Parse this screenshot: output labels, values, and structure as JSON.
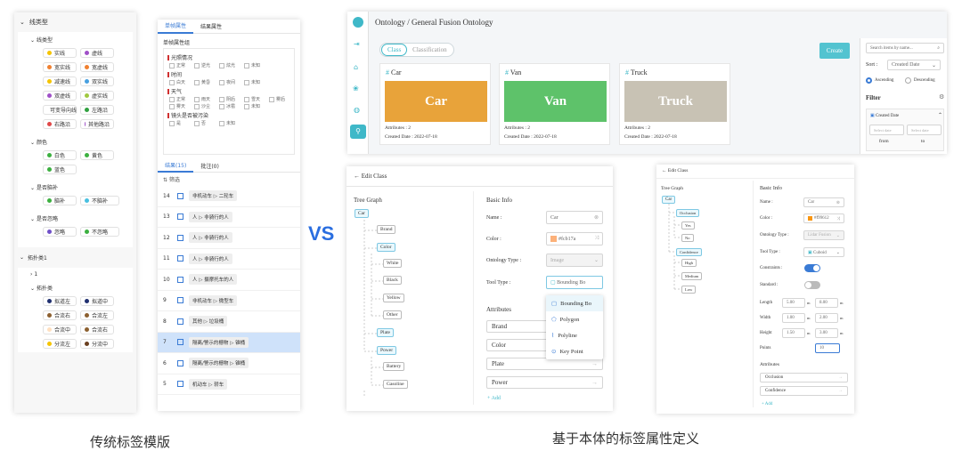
{
  "left": {
    "s1": "线类型",
    "s1sub": "线类型",
    "line_types": [
      [
        "实线",
        "#f5c400"
      ],
      [
        "虚线",
        "#a050c8"
      ],
      [
        "宽实线",
        "#f08030"
      ],
      [
        "宽虚线",
        "#f08030"
      ],
      [
        "减速线",
        "#f5c400"
      ],
      [
        "双实线",
        "#48a0e0"
      ],
      [
        "双虚线",
        "#a050c8"
      ],
      [
        "虚实线",
        "#a0c840"
      ],
      [
        "可变导向线",
        "#30b0b0"
      ],
      [
        "左路沿",
        "#30a040"
      ],
      [
        "右路沿",
        "#e04848"
      ],
      [
        "其他路沿",
        "#a050c8"
      ]
    ],
    "s2": "颜色",
    "colors": [
      [
        "白色",
        "#3cb040"
      ],
      [
        "黄色",
        "#3cb040"
      ],
      [
        "蓝色",
        "#3cb040"
      ]
    ],
    "s3": "是否脑补",
    "brain": [
      [
        "脑补",
        "#3cb040"
      ],
      [
        "不脑补",
        "#48c0e0"
      ]
    ],
    "s4": "是否忽略",
    "ignore": [
      [
        "忽略",
        "#7050c8"
      ],
      [
        "不忽略",
        "#3cb040"
      ]
    ],
    "topo": "拓扑类1",
    "one": "1",
    "topo_sub": "拓扑类",
    "topo_items": [
      [
        "拟道左",
        "#203070"
      ],
      [
        "拟道中",
        "#203070"
      ],
      [
        "合流右",
        "#8c6030"
      ],
      [
        "合流左",
        "#8c6030"
      ],
      [
        "合流中",
        "#ffe0c0"
      ],
      [
        "合流右",
        "#8c6030"
      ],
      [
        "分流左",
        "#f5c400"
      ],
      [
        "分流中",
        "#6a4020"
      ]
    ]
  },
  "mid": {
    "tabs": [
      "单帧属性",
      "结果属性"
    ],
    "group": "单帧属性组",
    "sections": [
      {
        "title": "光照情况",
        "opts": [
          "正常",
          "逆光",
          "炫光",
          "未知"
        ]
      },
      {
        "title": "时间",
        "opts": [
          "白天",
          "黄昏",
          "夜间",
          "未知"
        ]
      },
      {
        "title": "天气",
        "opts": [
          "正常",
          "雨天",
          "阴后",
          "雪天",
          "雾后",
          "雾天",
          "沙尘",
          "冰雹",
          "未知"
        ]
      },
      {
        "title": "镜头是否被污染",
        "opts": [
          "是",
          "否",
          "未知"
        ]
      }
    ],
    "res_tabs": [
      "结果(15)",
      "批注(0)"
    ],
    "filter": "筛选",
    "rows": [
      [
        "14",
        "非机动车 ▷ 二轮车"
      ],
      [
        "13",
        "人 ▷ 非骑行的人"
      ],
      [
        "12",
        "人 ▷ 非骑行的人"
      ],
      [
        "11",
        "人 ▷ 非骑行的人"
      ],
      [
        "10",
        "人 ▷ 摄摩托车的人"
      ],
      [
        "9",
        "非机动车 ▷ 微型车"
      ],
      [
        "8",
        "其他 ▷ 垃圾桶"
      ],
      [
        "7",
        "隔离/警示的栅物 ▷ 锥桶"
      ],
      [
        "6",
        "隔离/警示的栅物 ▷ 锥桶"
      ],
      [
        "5",
        "机动车 ▷ 轿车"
      ]
    ]
  },
  "vs": "VS",
  "cap_left": "传统标签模版",
  "cap_right": "基于本体的标签属性定义",
  "ont": {
    "bc": "Ontology",
    "bc2": "General Fusion Ontology",
    "tab1": "Class",
    "tab2": "Classification",
    "create": "Create",
    "search_ph": "Search items by name...",
    "sort": "Sort :",
    "sort_val": "Created Date",
    "asc": "Ascending",
    "desc": "Descending",
    "filter": "Filter",
    "cd": "Created Date",
    "sel1": "Select date",
    "sel2": "Select date",
    "from": "from",
    "to": "to",
    "cards": [
      {
        "name": "Car",
        "color": "#e8a33a",
        "attr": "Attributes :  2",
        "date": "Created Date :  2022-07-18"
      },
      {
        "name": "Van",
        "color": "#5ec26a",
        "attr": "Attributes :  2",
        "date": "Created Date :  2022-07-18"
      },
      {
        "name": "Truck",
        "color": "#c8c2b4",
        "attr": "Attributes :  2",
        "date": "Created Date :  2022-07-18"
      }
    ]
  },
  "edit1": {
    "title": "Edit Class",
    "tree": "Tree Graph",
    "root": "Car",
    "nodes": [
      "Brand",
      "Color",
      "White",
      "Black",
      "Yellow",
      "Other",
      "Plate",
      "Power",
      "Battery",
      "Gasoline"
    ],
    "basic": "Basic Info",
    "name_l": "Name :",
    "name_v": "Car",
    "color_l": "Color :",
    "color_v": "#fcb17a",
    "color_hex": "#fcb17a",
    "ont_l": "Ontology Type :",
    "ont_v": "Image",
    "tool_l": "Tool Type :",
    "tool_v": "Bounding Bo",
    "attrs": "Attributes",
    "attr_items": [
      "Brand",
      "Color",
      "Plate",
      "Power"
    ],
    "add": "Add",
    "menu": [
      "Bounding Bo",
      "Polygon",
      "Polyline",
      "Key Point"
    ]
  },
  "edit2": {
    "title": "Edit Class",
    "tree": "Tree Graph",
    "root": "Car",
    "nodes": [
      "Occlusion",
      "Yes",
      "No",
      "Confidence",
      "High",
      "Medium",
      "Low"
    ],
    "basic": "Basic Info",
    "name_l": "Name :",
    "name_v": "Car",
    "color_l": "Color :",
    "color_v": "#f99612",
    "ont_l": "Ontology Type :",
    "ont_v": "Lidar Fusion",
    "tool_l": "Tool Type :",
    "tool_v": "Cuboid",
    "cons": "Constraints :",
    "std": "Standard :",
    "len": "Length",
    "wid": "Width",
    "hei": "Height",
    "pts": "Points",
    "len_v": [
      "5.00",
      "8.00"
    ],
    "wid_v": [
      "1.00",
      "2.00"
    ],
    "hei_v": [
      "1.50",
      "3.00"
    ],
    "pts_v": "10",
    "m": "m",
    "to": "to",
    "attrs": "Attributes",
    "attr_items": [
      "Occlusion",
      "Confidence"
    ],
    "add": "Add"
  }
}
